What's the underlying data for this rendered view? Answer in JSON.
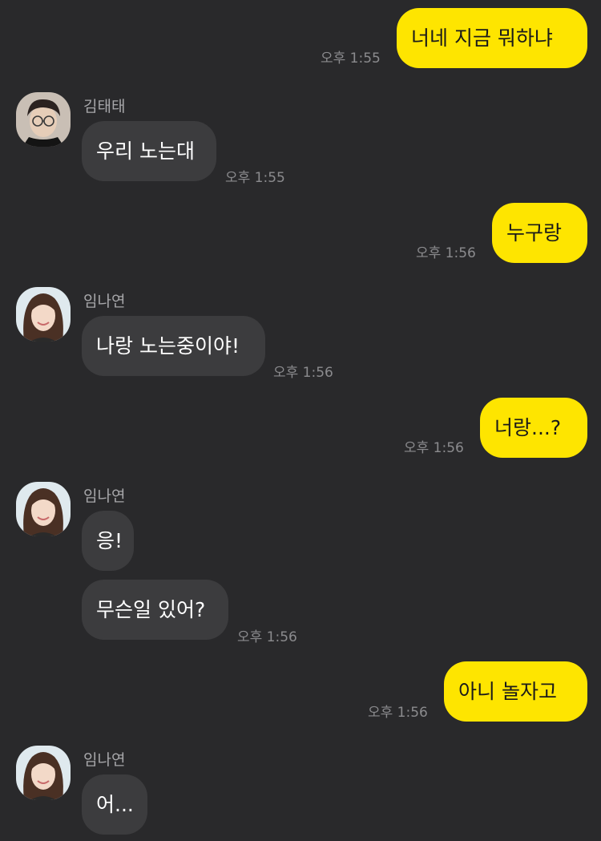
{
  "chat": {
    "m1": {
      "text": "너네 지금 뭐하냐",
      "time": "오후 1:55"
    },
    "m2": {
      "sender": "김태태",
      "text": "우리 노는대",
      "time": "오후 1:55"
    },
    "m3": {
      "text": "누구랑",
      "time": "오후 1:56"
    },
    "m4": {
      "sender": "임나연",
      "text": "나랑 노는중이야!",
      "time": "오후 1:56"
    },
    "m5": {
      "text": "너랑...?",
      "time": "오후 1:56"
    },
    "m6": {
      "sender": "임나연",
      "text1": "응!",
      "text2": "무슨일 있어?",
      "time": "오후 1:56"
    },
    "m7": {
      "text": "아니 놀자고",
      "time": "오후 1:56"
    },
    "m8": {
      "sender": "임나연",
      "text": "어..."
    }
  },
  "colors": {
    "background": "#29292b",
    "my_bubble": "#fee500",
    "other_bubble": "#3c3c3e"
  },
  "icons": {
    "avatar_kim": "avatar-boy-glasses-icon",
    "avatar_lim": "avatar-girl-icon"
  }
}
